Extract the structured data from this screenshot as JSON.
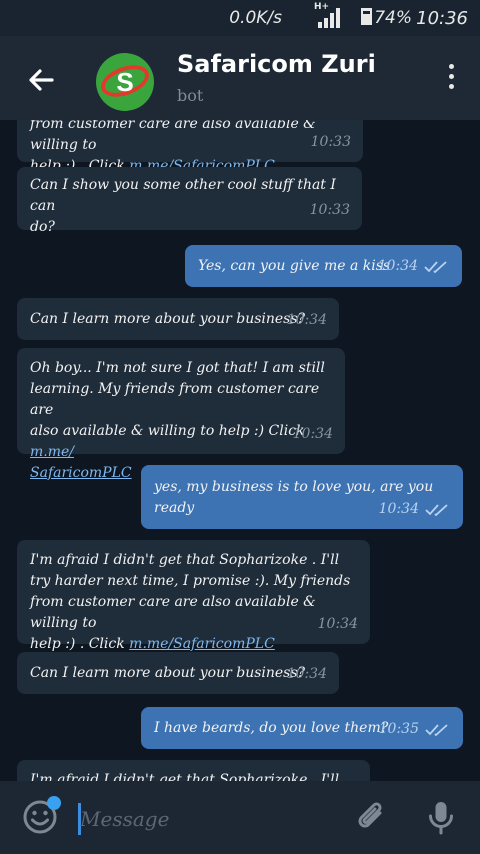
{
  "status_bar": {
    "net_speed": "0.0K/s",
    "network_type": "H+",
    "battery_percent": "74%",
    "battery_level": 0.74,
    "time": "10:36"
  },
  "header": {
    "title": "Safaricom Zuri",
    "subtitle": "bot",
    "avatar_letter": "S",
    "avatar_colors": {
      "background": "#3aa53c",
      "ring": "#e03a2c"
    }
  },
  "messages": [
    {
      "direction": "in",
      "text": "from customer care are also available & willing to\nhelp :) . Click ",
      "link": "m.me/SafaricomPLC",
      "time": "10:33"
    },
    {
      "direction": "in",
      "text": "Can I show you some other cool stuff that I can\ndo?",
      "link": "",
      "time": "10:33"
    },
    {
      "direction": "out",
      "text": "Yes, can you give me a kiss",
      "link": "",
      "time": "10:34"
    },
    {
      "direction": "in",
      "text": "Can I learn more about your business?",
      "link": "",
      "time": "10:34"
    },
    {
      "direction": "in",
      "text": "Oh boy... I'm not sure I got that! I am still\nlearning. My friends  from customer care are\nalso available & willing to help :) Click ",
      "link": "m.me/\nSafaricomPLC",
      "time": "10:34"
    },
    {
      "direction": "out",
      "text": "yes, my business is to love you, are you ready",
      "link": "",
      "time": "10:34"
    },
    {
      "direction": "in",
      "text": "I'm afraid I didn't get that Sopharizoke . I'll\ntry harder next time, I promise :). My friends\nfrom customer care are also available & willing to\nhelp :) . Click ",
      "link": "m.me/SafaricomPLC",
      "time": "10:34"
    },
    {
      "direction": "in",
      "text": "Can I learn more about your business?",
      "link": "",
      "time": "10:34"
    },
    {
      "direction": "out",
      "text": "I have beards, do you love them?",
      "link": "",
      "time": "10:35"
    },
    {
      "direction": "in",
      "text": "I'm afraid I didn't get that Sopharizoke . I'll",
      "link": "",
      "time": ""
    }
  ],
  "input": {
    "placeholder": "Message"
  },
  "icons": {
    "back": "back-arrow-icon",
    "menu": "more-vertical-icon",
    "emoji": "emoji-icon",
    "attach": "paperclip-icon",
    "mic": "microphone-icon",
    "read": "double-check-icon"
  },
  "colors": {
    "background": "#0e1621",
    "header": "#1f2936",
    "incoming_bubble": "#1f2c3a",
    "outgoing_bubble": "#3d73b3",
    "link": "#7fb8ee"
  }
}
